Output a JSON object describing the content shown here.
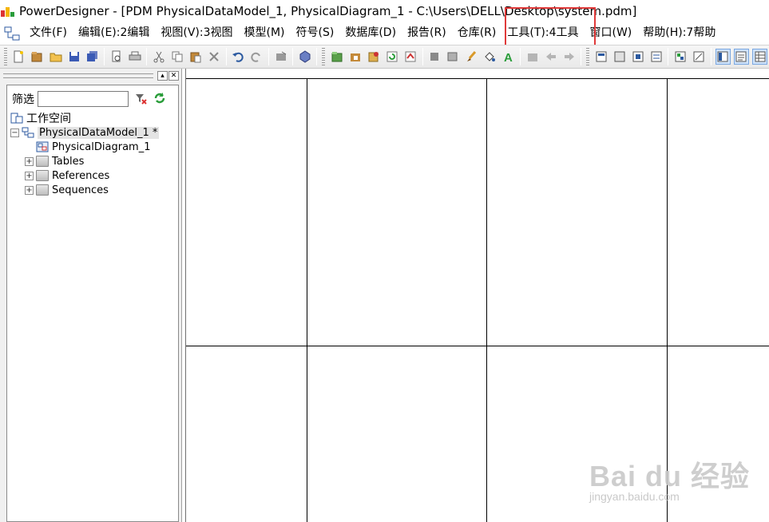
{
  "window": {
    "title": "PowerDesigner - [PDM PhysicalDataModel_1, PhysicalDiagram_1 - C:\\Users\\DELL\\Desktop\\system.pdm]"
  },
  "menu": {
    "items": [
      {
        "label": "文件(F)"
      },
      {
        "label": "编辑(E):2编辑"
      },
      {
        "label": "视图(V):3视图"
      },
      {
        "label": "模型(M)"
      },
      {
        "label": "符号(S)"
      },
      {
        "label": "数据库(D)"
      },
      {
        "label": "报告(R)"
      },
      {
        "label": "仓库(R)"
      },
      {
        "label": "工具(T):4工具"
      },
      {
        "label": "窗口(W)"
      },
      {
        "label": "帮助(H):7帮助"
      }
    ],
    "highlighted": "工具(T):4工具",
    "highlight_color": "#e03a3a"
  },
  "toolbar": {
    "icons": [
      "new-icon",
      "open-project-icon",
      "open-icon",
      "save-icon",
      "save-all-icon",
      "print-preview-icon",
      "print-icon",
      "cut-icon",
      "copy-icon",
      "paste-icon",
      "delete-icon",
      "undo-icon",
      "redo-icon",
      "properties-icon",
      "check-model-icon",
      "new-package-icon",
      "open-package-icon",
      "model-icon",
      "refresh-icon",
      "merge-icon",
      "shape-icon",
      "format-icon",
      "brush-icon",
      "fill-icon",
      "font-icon",
      "group-icon",
      "back-icon",
      "forward-icon",
      "symbol-a-icon",
      "symbol-b-icon",
      "symbol-c-icon",
      "symbol-d-icon",
      "symbol-e-icon",
      "symbol-f-icon",
      "browser-toggle-icon",
      "output-toggle-icon",
      "result-toggle-icon"
    ]
  },
  "browser": {
    "filter_label": "筛选",
    "filter_value": "",
    "tree": [
      {
        "label": "工作空间",
        "level": 0,
        "expander": ""
      },
      {
        "label": "PhysicalDataModel_1 *",
        "level": 1,
        "expander": "−",
        "selected": true
      },
      {
        "label": "PhysicalDiagram_1",
        "level": 2,
        "expander": ""
      },
      {
        "label": "Tables",
        "level": 2,
        "expander": "+"
      },
      {
        "label": "References",
        "level": 2,
        "expander": "+"
      },
      {
        "label": "Sequences",
        "level": 2,
        "expander": "+"
      }
    ]
  },
  "watermark": {
    "brand": "Bai du 经验",
    "url": "jingyan.baidu.com"
  }
}
